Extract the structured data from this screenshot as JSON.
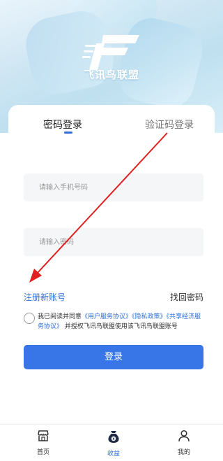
{
  "header": {
    "brand": "飞讯鸟联盟"
  },
  "tabs": [
    {
      "label": "密码登录",
      "active": true
    },
    {
      "label": "验证码登录",
      "active": false
    }
  ],
  "form": {
    "phone_placeholder": "请输入手机号码",
    "password_placeholder": "请输入密码",
    "register_label": "注册新账号",
    "forgot_label": "找回密码",
    "agree": {
      "prefix": "我已阅读并同意",
      "user_agreement": "《用户服务协议》",
      "privacy_policy": "《隐私政策》",
      "sharing_agreement": "《共享经济服务协议》",
      "suffix": "并授权飞讯鸟联盟使用该飞讯鸟联盟账号"
    },
    "login_label": "登录"
  },
  "tabbar": {
    "items": [
      {
        "label": "首页",
        "icon": "store-icon"
      },
      {
        "label": "收益",
        "icon": "money-bag-icon"
      },
      {
        "label": "我的",
        "icon": "user-icon"
      }
    ]
  },
  "colors": {
    "accent": "#3876e8",
    "link": "#2f6fd6",
    "annotation_arrow": "#e02020"
  }
}
